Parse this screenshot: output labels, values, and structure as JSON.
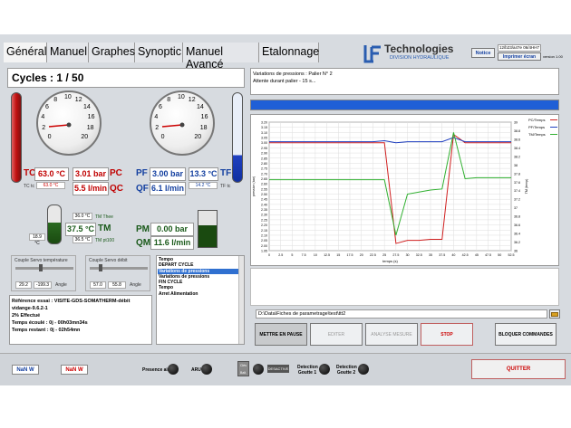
{
  "tabs": [
    "Général",
    "Manuel",
    "Graphes",
    "Synoptic",
    "Manuel Avancé",
    "Etalonnage"
  ],
  "logo": {
    "brand": "Technologies",
    "sub": "DIVISION HYDRAULIQUE"
  },
  "header": {
    "notice": "Notice",
    "print": "Imprimer écran",
    "code": "12/b23/a47e 06/4HH7",
    "version": "version 1.00"
  },
  "cycles": "Cycles : 1 / 50",
  "dial_ticks": [
    "0",
    "2",
    "4",
    "6",
    "8",
    "10",
    "12",
    "14",
    "16",
    "18",
    "20"
  ],
  "left_gauge": {
    "tc_label": "TC",
    "tc_value": "63.0 °C",
    "pc_label": "PC",
    "pc_value": "3.01 bar",
    "qc_label": "QC",
    "qc_value": "5.5 l/min",
    "tc_small_label": "TC tc",
    "tc_small": "63.0 °C"
  },
  "right_gauge": {
    "pf_label": "PF",
    "pf_value": "3.00 bar",
    "tf_label": "TF",
    "tf_value": "13.3 °C",
    "qf_label": "QF",
    "qf_value": "6.1 l/min",
    "tf_small": "14.2 °C",
    "tf_small_label": "TF tc"
  },
  "tank": {
    "tm_label": "TM",
    "tm_value": "37.5 °C",
    "tm_top": "36.0 °C",
    "tm_top_label": "TM Thee",
    "tm_bottom": "36.5 °C",
    "tm_bottom_label": "TM pt100",
    "side": "18.9 °C"
  },
  "pm": {
    "pm_label": "PM",
    "pm_value": "0.00 bar",
    "qm_label": "QM",
    "qm_value": "11.6 l/min"
  },
  "servo_temp": {
    "title": "Couple Servo température",
    "v1": "29.2",
    "v2": "-199.3",
    "unit": "Angle"
  },
  "servo_debit": {
    "title": "Couple Servo débit",
    "v1": "57.0",
    "v2": "55.8",
    "unit": "Angle"
  },
  "info_lines": [
    "Référence essai : VISITE-GDS-SOMATHERM-débit",
    "vidange-9.6.2-1",
    "2%  Effectué",
    "Temps écoulé : 0j - 00h03mn34s",
    "Temps restant : 0j - 02h54mn"
  ],
  "steps": [
    "Tempo",
    "DEPART CYCLE",
    "Variations de pressions",
    "Variations de pressions",
    "FIN CYCLE",
    "Tempo",
    "Arret Alimentation"
  ],
  "steps_selected": 2,
  "status_lines": [
    "Variations de pressions : Palier N° 2",
    "Attente durant palier -  15 s..."
  ],
  "progress": 1.0,
  "file_path": "D:\\Data\\Fiches de parametrage\\test\\ttt2",
  "buttons": {
    "pause": "METTRE EN PAUSE",
    "edit": "EDITER",
    "analyse": "ANALYSE MESURE",
    "stop": "STOP",
    "lock": "BLOQUER COMMANDES",
    "quit": "QUITTER"
  },
  "footer": {
    "nan1": "NaN W",
    "nan2": "NaN W",
    "presence": "Presence air",
    "aru": "ARU",
    "detect1": "Detection Goutte 1",
    "detect2": "Detection Goutte 2",
    "deactivate": "DESACTIVE",
    "cles": "Clés Balt."
  },
  "chart_data": {
    "type": "line",
    "xlabel": "temps (s)",
    "ylabel": "pression (bar)",
    "y2label": "TM (temp)",
    "x": [
      0,
      2.5,
      5,
      7.5,
      10,
      12.5,
      15,
      17.5,
      20,
      22.5,
      25,
      27.5,
      30,
      32.5,
      35,
      37.5,
      40,
      42.5,
      45,
      47.5,
      50,
      52.5
    ],
    "xlim": [
      0,
      52.5
    ],
    "ylim": [
      1.95,
      3.2
    ],
    "y2lim": [
      36.0,
      39.0
    ],
    "yticks": [
      "3.20",
      "3.15",
      "3.10",
      "3.05",
      "3.00",
      "2.95",
      "2.90",
      "2.85",
      "2.80",
      "2.75",
      "2.70",
      "2.65",
      "2.60",
      "2.55",
      "2.50",
      "2.45",
      "2.40",
      "2.35",
      "2.30",
      "2.25",
      "2.20",
      "2.15",
      "2.10",
      "2.05",
      "2.00",
      "1.95"
    ],
    "y2ticks": [
      "39",
      "38.8",
      "38.6",
      "38.4",
      "38.2",
      "38",
      "37.8",
      "37.6",
      "37.4",
      "37.2",
      "37",
      "36.8",
      "36.6",
      "36.4",
      "36.2",
      "36"
    ],
    "series": [
      {
        "name": "PC/Temps",
        "color": "#d02020",
        "values": [
          3.0,
          3.0,
          3.0,
          3.0,
          3.0,
          3.0,
          3.0,
          3.0,
          3.0,
          3.0,
          3.0,
          2.02,
          2.05,
          2.05,
          2.06,
          2.06,
          3.08,
          3.0,
          3.0,
          3.0,
          3.0,
          3.0
        ]
      },
      {
        "name": "PF/Temps",
        "color": "#2040c0",
        "values": [
          3.01,
          3.01,
          3.01,
          3.01,
          3.01,
          3.01,
          3.01,
          3.01,
          3.01,
          3.01,
          3.02,
          3.0,
          3.01,
          3.01,
          3.01,
          3.01,
          3.05,
          3.01,
          3.01,
          3.01,
          3.01,
          3.01
        ]
      },
      {
        "name": "TM/Temps",
        "color": "#30b030",
        "values": [
          2.64,
          2.64,
          2.64,
          2.64,
          2.64,
          2.64,
          2.64,
          2.64,
          2.64,
          2.64,
          2.64,
          2.1,
          2.5,
          2.52,
          2.54,
          2.55,
          3.1,
          2.65,
          2.66,
          2.66,
          2.66,
          2.66
        ]
      }
    ]
  }
}
